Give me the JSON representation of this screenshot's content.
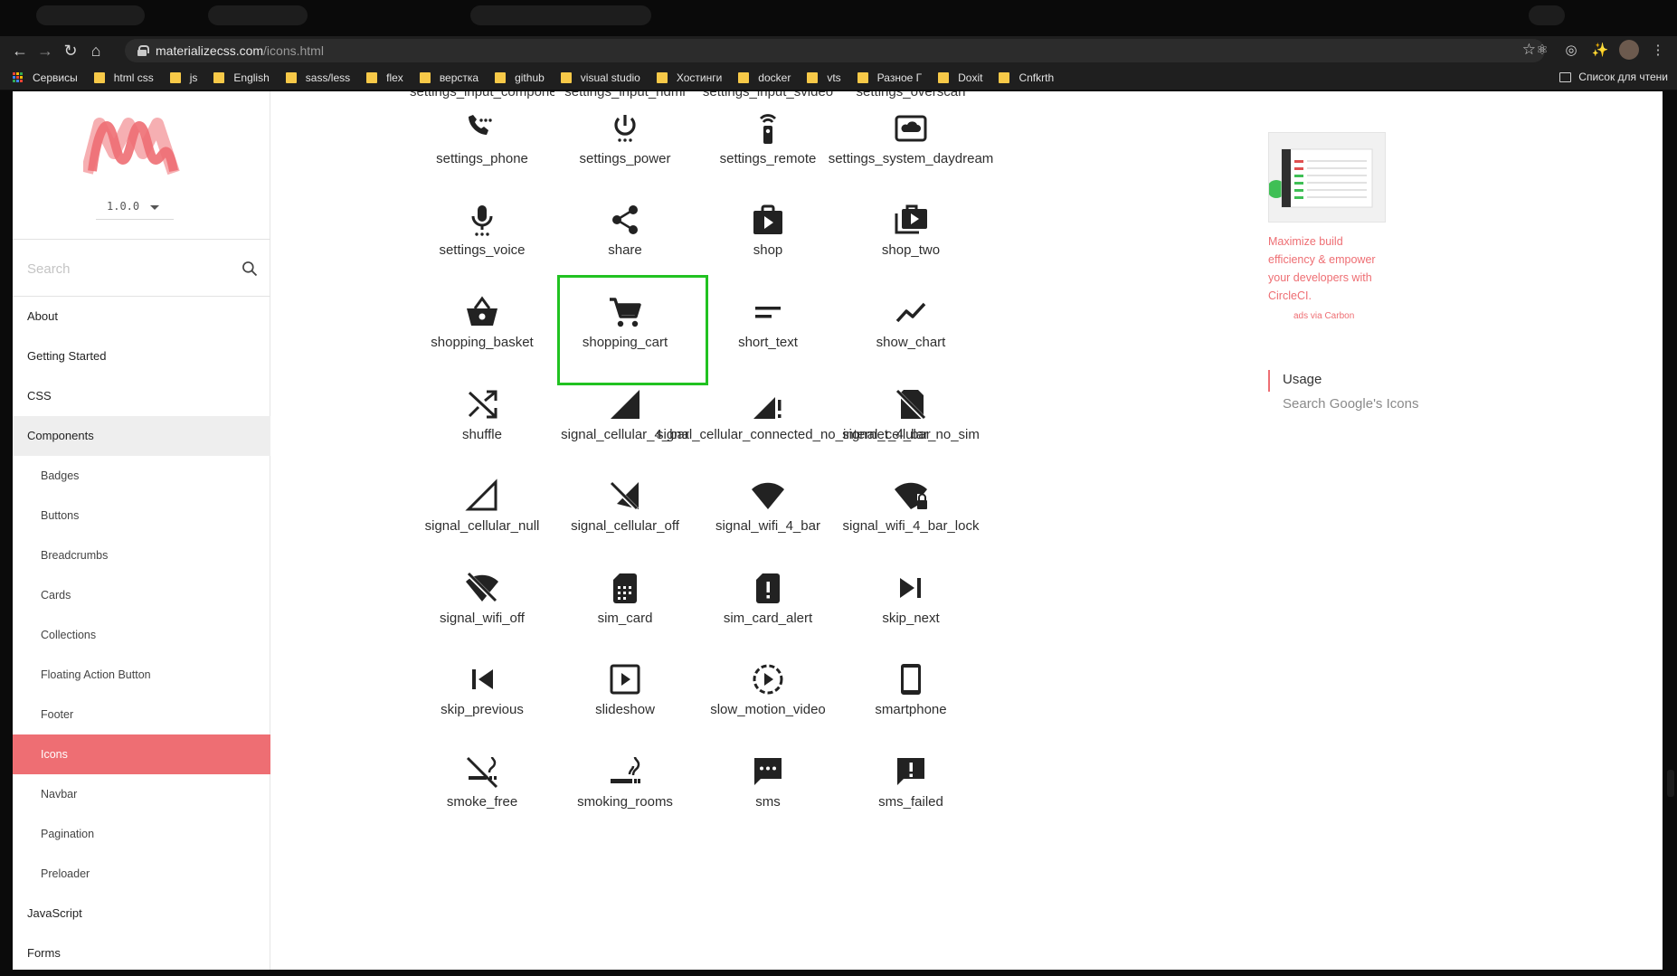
{
  "browser": {
    "url_host": "materializecss.com",
    "url_path": "/icons.html",
    "bookmarks": [
      {
        "label": "Сервисы",
        "type": "apps"
      },
      {
        "label": "html css",
        "type": "folder"
      },
      {
        "label": "js",
        "type": "folder"
      },
      {
        "label": "English",
        "type": "folder"
      },
      {
        "label": "sass/less",
        "type": "folder"
      },
      {
        "label": "flex",
        "type": "folder"
      },
      {
        "label": "верстка",
        "type": "folder"
      },
      {
        "label": "github",
        "type": "folder"
      },
      {
        "label": "visual studio",
        "type": "folder"
      },
      {
        "label": "Хостинги",
        "type": "folder"
      },
      {
        "label": "docker",
        "type": "folder"
      },
      {
        "label": "vts",
        "type": "folder"
      },
      {
        "label": "Разное Г",
        "type": "folder"
      },
      {
        "label": "Doxit",
        "type": "folder"
      },
      {
        "label": "Cnfkrth",
        "type": "folder"
      }
    ],
    "reading_list": "Список для чтени",
    "colors": {
      "folder": "#f7c948",
      "chrome": "#1f1f1f"
    }
  },
  "sidebar": {
    "version": "1.0.0",
    "search_placeholder": "Search",
    "items": [
      {
        "label": "About",
        "level": 0
      },
      {
        "label": "Getting Started",
        "level": 0
      },
      {
        "label": "CSS",
        "level": 0
      },
      {
        "label": "Components",
        "level": 0,
        "expanded": true
      },
      {
        "label": "Badges",
        "level": 1
      },
      {
        "label": "Buttons",
        "level": 1
      },
      {
        "label": "Breadcrumbs",
        "level": 1
      },
      {
        "label": "Cards",
        "level": 1
      },
      {
        "label": "Collections",
        "level": 1
      },
      {
        "label": "Floating Action Button",
        "level": 1
      },
      {
        "label": "Footer",
        "level": 1
      },
      {
        "label": "Icons",
        "level": 1,
        "active": true
      },
      {
        "label": "Navbar",
        "level": 1
      },
      {
        "label": "Pagination",
        "level": 1
      },
      {
        "label": "Preloader",
        "level": 1
      },
      {
        "label": "JavaScript",
        "level": 0
      },
      {
        "label": "Forms",
        "level": 0
      }
    ],
    "accent": "#ee6e73"
  },
  "icons": {
    "cut_off_row": [
      "settings_input_component",
      "settings_input_hdmi",
      "settings_input_svideo",
      "settings_overscan"
    ],
    "rows": [
      [
        "settings_phone",
        "settings_power",
        "settings_remote",
        "settings_system_daydream"
      ],
      [
        "settings_voice",
        "share",
        "shop",
        "shop_two"
      ],
      [
        "shopping_basket",
        "shopping_cart",
        "short_text",
        "show_chart"
      ],
      [
        "shuffle",
        "signal_cellular_4_bar",
        "signal_cellular_connected_no_internet_4_bar",
        "signal_cellular_no_sim"
      ],
      [
        "signal_cellular_null",
        "signal_cellular_off",
        "signal_wifi_4_bar",
        "signal_wifi_4_bar_lock"
      ],
      [
        "signal_wifi_off",
        "sim_card",
        "sim_card_alert",
        "skip_next"
      ],
      [
        "skip_previous",
        "slideshow",
        "slow_motion_video",
        "smartphone"
      ],
      [
        "smoke_free",
        "smoking_rooms",
        "sms",
        "sms_failed"
      ]
    ],
    "highlighted": "shopping_cart",
    "highlight_color": "#21c221"
  },
  "ad": {
    "text": "Maximize build efficiency & empower your developers with CircleCI.",
    "via": "ads via Carbon"
  },
  "toc": {
    "usage": "Usage",
    "link": "Search Google's Icons"
  }
}
